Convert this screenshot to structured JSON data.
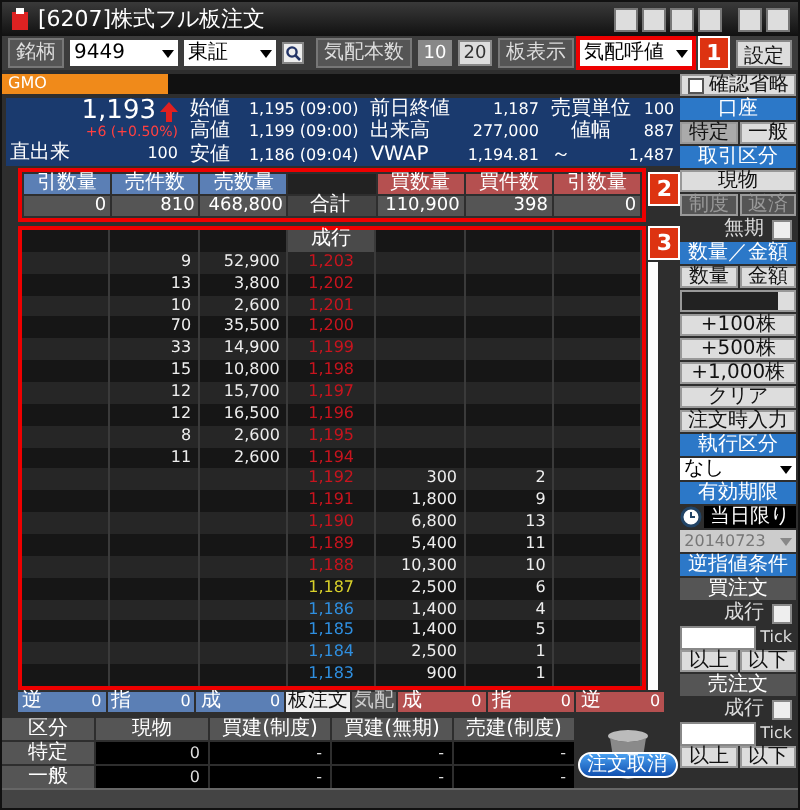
{
  "window": {
    "title": "[6207]株式フル板注文"
  },
  "toolbar": {
    "symbol_label": "銘柄",
    "symbol": "9449",
    "market": "東証",
    "depth_label": "気配本数",
    "depth_options": [
      {
        "label": "10",
        "selected": true
      },
      {
        "label": "20",
        "selected": false
      }
    ],
    "display_label": "板表示",
    "display": "気配呼値",
    "settings": "設定"
  },
  "annotations": [
    {
      "label": "1"
    },
    {
      "label": "2"
    },
    {
      "label": "3"
    }
  ],
  "tabs": [
    {
      "label": "GMO",
      "selected": true
    }
  ],
  "quote": {
    "price": "1,193",
    "change": "+6 (+0.50%)",
    "last_volume_label": "直出来",
    "last_volume": "100",
    "stats": [
      {
        "label": "始値",
        "value": "1,195 (09:00)"
      },
      {
        "label": "前日終値",
        "value": "1,187"
      },
      {
        "label": "売買単位",
        "value": "100"
      },
      {
        "label": "高値",
        "value": "1,199 (09:00)"
      },
      {
        "label": "出来高",
        "value": "277,000"
      },
      {
        "label": "値幅",
        "value": "887"
      },
      {
        "label": "安値",
        "value": "1,186 (09:04)"
      },
      {
        "label": "VWAP",
        "value": "1,194.81"
      }
    ],
    "range_upper": {
      "mark": "～",
      "value": "1,487"
    }
  },
  "summary": {
    "sell_columns": [
      "引数量",
      "売件数",
      "売数量"
    ],
    "buy_columns": [
      "買数量",
      "買件数",
      "引数量"
    ],
    "total_label": "合計",
    "values": [
      "0",
      "810",
      "468,800",
      "110,900",
      "398",
      "0"
    ]
  },
  "book": {
    "market_label": "成行",
    "rows": [
      {
        "sell_count": "9",
        "sell_qty": "52,900",
        "price": "1,203",
        "color": "#c8141e"
      },
      {
        "sell_count": "13",
        "sell_qty": "3,800",
        "price": "1,202",
        "color": "#c8141e"
      },
      {
        "sell_count": "10",
        "sell_qty": "2,600",
        "price": "1,201",
        "color": "#c8141e"
      },
      {
        "sell_count": "70",
        "sell_qty": "35,500",
        "price": "1,200",
        "color": "#c8141e"
      },
      {
        "sell_count": "33",
        "sell_qty": "14,900",
        "price": "1,199",
        "color": "#c8141e"
      },
      {
        "sell_count": "15",
        "sell_qty": "10,800",
        "price": "1,198",
        "color": "#c8141e"
      },
      {
        "sell_count": "12",
        "sell_qty": "15,700",
        "price": "1,197",
        "color": "#c8141e"
      },
      {
        "sell_count": "12",
        "sell_qty": "16,500",
        "price": "1,196",
        "color": "#c8141e"
      },
      {
        "sell_count": "8",
        "sell_qty": "2,600",
        "price": "1,195",
        "color": "#c8141e"
      },
      {
        "sell_count": "11",
        "sell_qty": "2,600",
        "price": "1,194",
        "color": "#c8141e"
      },
      {
        "price": "1,192",
        "buy_qty": "300",
        "buy_count": "2",
        "color": "#c8141e"
      },
      {
        "price": "1,191",
        "buy_qty": "1,800",
        "buy_count": "9",
        "color": "#c8141e"
      },
      {
        "price": "1,190",
        "buy_qty": "6,800",
        "buy_count": "13",
        "color": "#c8141e"
      },
      {
        "price": "1,189",
        "buy_qty": "5,400",
        "buy_count": "11",
        "color": "#c8141e"
      },
      {
        "price": "1,188",
        "buy_qty": "10,300",
        "buy_count": "10",
        "color": "#c8141e"
      },
      {
        "price": "1,187",
        "buy_qty": "2,500",
        "buy_count": "6",
        "color": "#d8d02a"
      },
      {
        "price": "1,186",
        "buy_qty": "1,400",
        "buy_count": "4",
        "color": "#2f8fe0"
      },
      {
        "price": "1,185",
        "buy_qty": "1,400",
        "buy_count": "5",
        "color": "#2f8fe0"
      },
      {
        "price": "1,184",
        "buy_qty": "2,500",
        "buy_count": "1",
        "color": "#2f8fe0"
      },
      {
        "price": "1,183",
        "buy_qty": "900",
        "buy_count": "1",
        "color": "#2f8fe0"
      }
    ]
  },
  "footer": {
    "sell": [
      {
        "label": "逆",
        "value": "0"
      },
      {
        "label": "指",
        "value": "0"
      },
      {
        "label": "成",
        "value": "0"
      }
    ],
    "buttons": [
      {
        "label": "板注文",
        "selected": true
      },
      {
        "label": "気配",
        "selected": false
      }
    ],
    "buy": [
      {
        "label": "成",
        "value": "0"
      },
      {
        "label": "指",
        "value": "0"
      },
      {
        "label": "逆",
        "value": "0"
      }
    ]
  },
  "positions": {
    "columns": [
      "区分",
      "現物",
      "買建(制度)",
      "買建(無期)",
      "売建(制度)"
    ],
    "rows": [
      {
        "label": "特定",
        "cells": [
          "0",
          "-",
          "-",
          "-"
        ]
      },
      {
        "label": "一般",
        "cells": [
          "0",
          "-",
          "-",
          "-"
        ]
      }
    ]
  },
  "cancel_button": "注文取消",
  "side_panel": [
    {
      "kind": "checkbox",
      "label": "確認省略",
      "checked": false
    },
    {
      "kind": "header",
      "label": "口座"
    },
    {
      "kind": "pair",
      "buttons": [
        {
          "label": "特定",
          "selected": true,
          "disabled": false
        },
        {
          "label": "一般",
          "selected": false,
          "disabled": false
        }
      ]
    },
    {
      "kind": "header",
      "label": "取引区分"
    },
    {
      "kind": "button",
      "label": "現物"
    },
    {
      "kind": "pair",
      "buttons": [
        {
          "label": "制度",
          "selected": false,
          "disabled": true
        },
        {
          "label": "返済",
          "selected": false,
          "disabled": true
        }
      ]
    },
    {
      "kind": "toggle",
      "label": "無期",
      "checked": false
    },
    {
      "kind": "header",
      "label": "数量／金額"
    },
    {
      "kind": "pair",
      "buttons": [
        {
          "label": "数量",
          "selected": false,
          "disabled": false
        },
        {
          "label": "金額",
          "selected": false,
          "disabled": false
        }
      ]
    },
    {
      "kind": "input"
    },
    {
      "kind": "button",
      "label": "+100株"
    },
    {
      "kind": "button",
      "label": "+500株"
    },
    {
      "kind": "button",
      "label": "+1,000株"
    },
    {
      "kind": "button",
      "label": "クリア"
    },
    {
      "kind": "button",
      "label": "注文時入力"
    },
    {
      "kind": "header",
      "label": "執行区分"
    },
    {
      "kind": "select",
      "label": "なし"
    },
    {
      "kind": "header",
      "label": "有効期限"
    },
    {
      "kind": "clock",
      "label": "当日限り"
    },
    {
      "kind": "date",
      "label": "20140723"
    },
    {
      "kind": "header",
      "label": "逆指値条件"
    },
    {
      "kind": "band",
      "label": "買注文"
    },
    {
      "kind": "toggle",
      "label": "成行",
      "checked": false
    },
    {
      "kind": "tick",
      "label": "Tick"
    },
    {
      "kind": "pair",
      "buttons": [
        {
          "label": "以上",
          "selected": false,
          "disabled": false
        },
        {
          "label": "以下",
          "selected": false,
          "disabled": false
        }
      ]
    },
    {
      "kind": "band",
      "label": "売注文"
    },
    {
      "kind": "toggle",
      "label": "成行",
      "checked": false
    },
    {
      "kind": "tick",
      "label": "Tick"
    },
    {
      "kind": "pair",
      "buttons": [
        {
          "label": "以上",
          "selected": false,
          "disabled": false
        },
        {
          "label": "以下",
          "selected": false,
          "disabled": false
        }
      ]
    }
  ]
}
